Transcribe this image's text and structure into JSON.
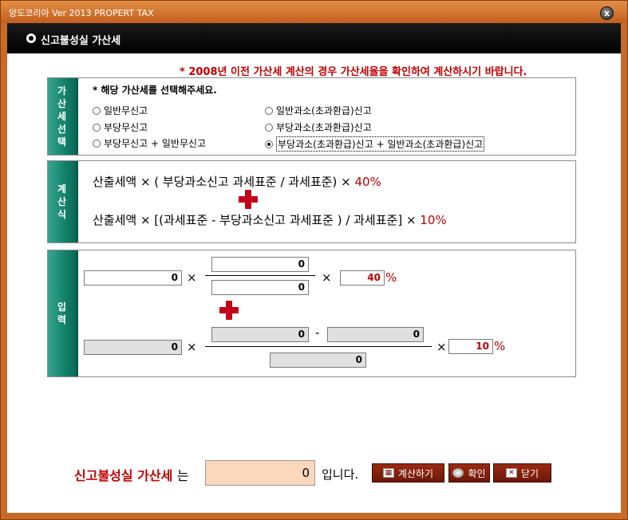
{
  "window": {
    "title": "양도코리아 Ver 2013  PROPERT  TAX",
    "close_glyph": "x"
  },
  "header": {
    "title": "신고불성실 가산세"
  },
  "notice": "* 2008년 이전 가산세 계산의 경우 가산세율을 확인하여 계산하시기 바랍니다.",
  "selection": {
    "tab_label": "가산세선택",
    "instruction": "* 해당 가산세를 선택해주세요.",
    "options": [
      {
        "label": "일반무신고",
        "selected": false
      },
      {
        "label": "일반과소(초과환급)신고",
        "selected": false
      },
      {
        "label": "부당무신고",
        "selected": false
      },
      {
        "label": "부당과소(초과환급)신고",
        "selected": false
      },
      {
        "label": "부당무신고 + 일반무신고",
        "selected": false
      },
      {
        "label": "부당과소(초과환급)신고 + 일반과소(초과환급)신고",
        "selected": true
      }
    ]
  },
  "formula": {
    "tab_label": "계산식",
    "line1_text": "산출세액 × ( 부당과소신고 과세표준 / 과세표준) × ",
    "line1_rate": "40%",
    "line2_text": "산출세액 × [(과세표준 - 부당과소신고 과세표준 ) / 과세표준] × ",
    "line2_rate": "10%"
  },
  "input": {
    "tab_label": "입력",
    "multiply": "×",
    "minus": "-",
    "percent": "%",
    "row1": {
      "tax": "0",
      "numerator": "0",
      "denominator": "0",
      "rate": "40"
    },
    "row2": {
      "tax": "0",
      "numerator_a": "0",
      "numerator_b": "0",
      "denominator": "0",
      "rate": "10"
    }
  },
  "result": {
    "label": "신고불성실 가산세",
    "label_suffix": "는",
    "value": "0",
    "tail": "입니다."
  },
  "buttons": {
    "calculate": "계산하기",
    "confirm": "확인",
    "close": "닫기"
  },
  "colors": {
    "accent_red": "#c00000",
    "tab_green": "#11826b",
    "frame_orange": "#c86a28",
    "button_brown": "#7a1e0a"
  }
}
